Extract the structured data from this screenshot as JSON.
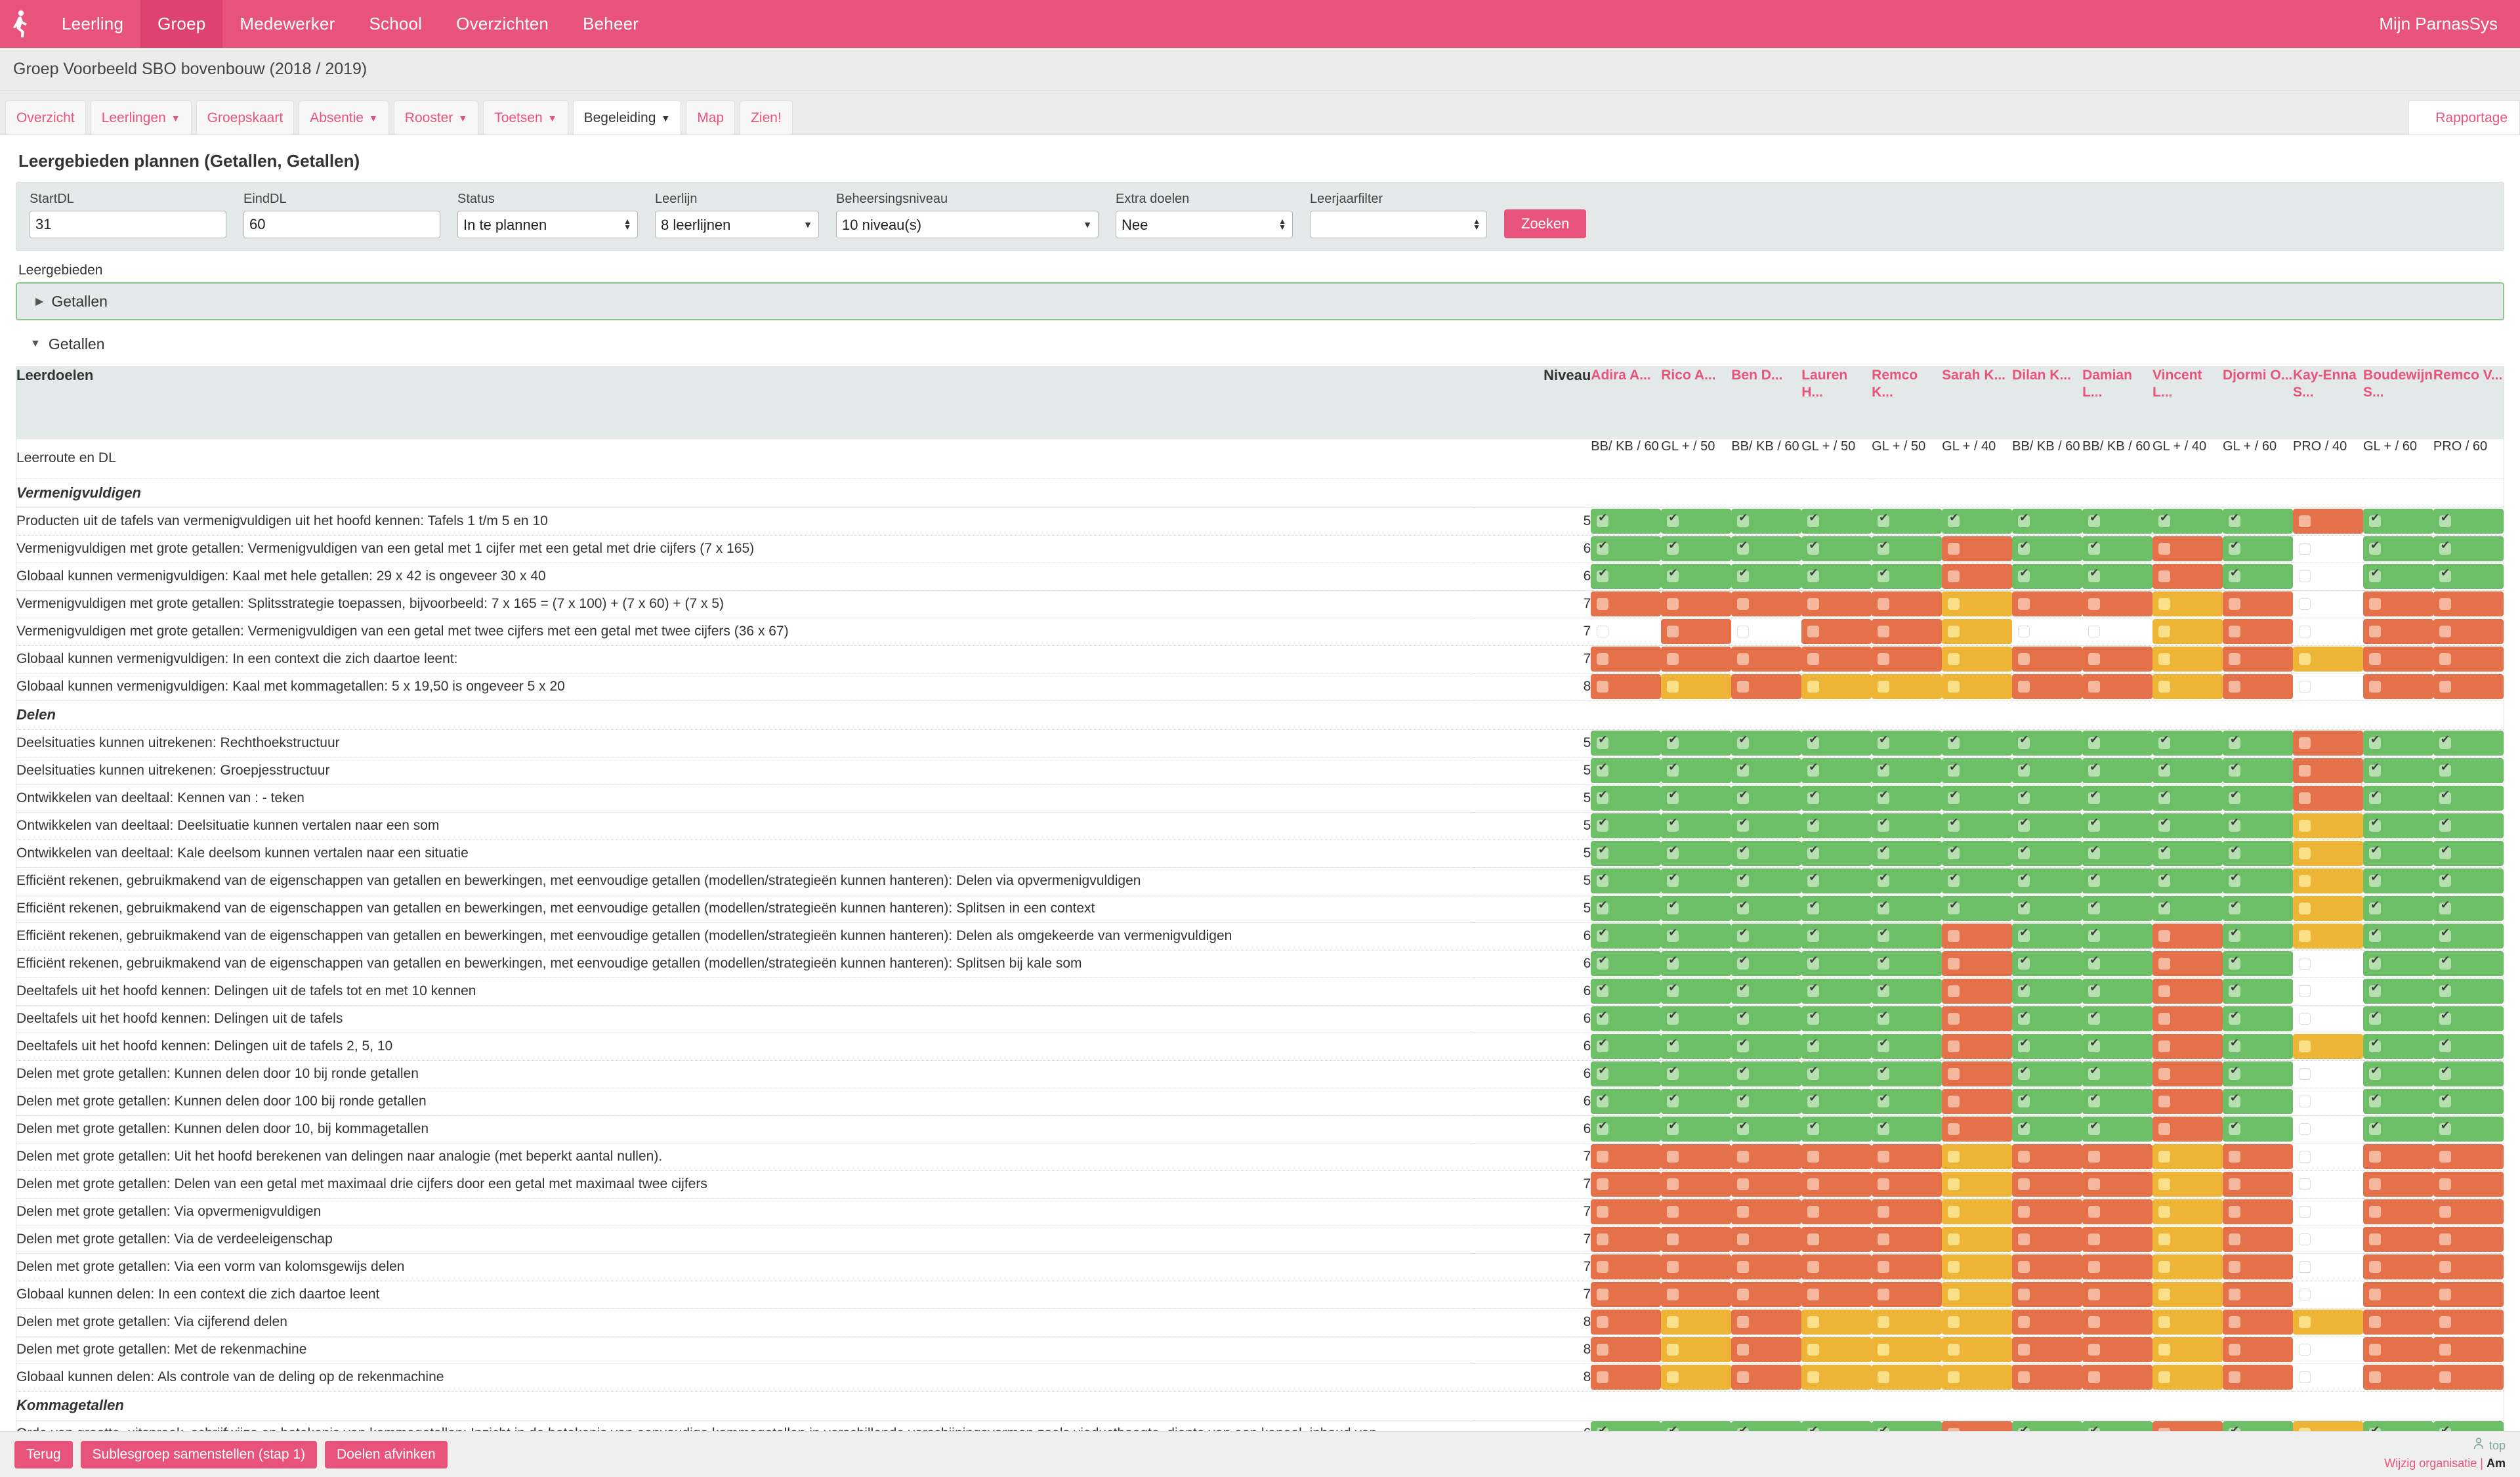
{
  "topnav": {
    "logo_icon": "running-person-logo",
    "items": [
      {
        "label": "Leerling",
        "active": false
      },
      {
        "label": "Groep",
        "active": true
      },
      {
        "label": "Medewerker",
        "active": false
      },
      {
        "label": "School",
        "active": false
      },
      {
        "label": "Overzichten",
        "active": false
      },
      {
        "label": "Beheer",
        "active": false
      }
    ],
    "account_label": "Mijn ParnasSys"
  },
  "titlebar": {
    "title": "Groep Voorbeeld SBO bovenbouw (2018 / 2019)"
  },
  "tabs": [
    {
      "label": "Overzicht",
      "caret": false,
      "active": false
    },
    {
      "label": "Leerlingen",
      "caret": true,
      "active": false
    },
    {
      "label": "Groepskaart",
      "caret": false,
      "active": false
    },
    {
      "label": "Absentie",
      "caret": true,
      "active": false
    },
    {
      "label": "Rooster",
      "caret": true,
      "active": false
    },
    {
      "label": "Toetsen",
      "caret": true,
      "active": false
    },
    {
      "label": "Begeleiding",
      "caret": true,
      "active": true
    },
    {
      "label": "Map",
      "caret": false,
      "active": false
    },
    {
      "label": "Zien!",
      "caret": false,
      "active": false
    }
  ],
  "rapportage_link": "Rapportage",
  "page_title": "Leergebieden plannen (Getallen, Getallen)",
  "filters": {
    "startdl": {
      "label": "StartDL",
      "value": "31"
    },
    "einddl": {
      "label": "EindDL",
      "value": "60"
    },
    "status": {
      "label": "Status",
      "value": "In te plannen"
    },
    "leerlijn": {
      "label": "Leerlijn",
      "value": "8 leerlijnen"
    },
    "beheersingsniveau": {
      "label": "Beheersingsniveau",
      "value": "10 niveau(s)"
    },
    "extra_doelen": {
      "label": "Extra doelen",
      "value": "Nee"
    },
    "leerjaarfilter": {
      "label": "Leerjaarfilter",
      "value": ""
    },
    "search_button": "Zoeken"
  },
  "leergebieden": {
    "label": "Leergebieden",
    "closed_item": "Getallen",
    "open_item": "Getallen"
  },
  "table": {
    "col_goal": "Leerdoelen",
    "col_niveau": "Niveau",
    "route_label": "Leerroute en DL",
    "students": [
      {
        "name": "Adira A...",
        "route": "BB/ KB / 60"
      },
      {
        "name": "Rico A...",
        "route": "GL + / 50"
      },
      {
        "name": "Ben D...",
        "route": "BB/ KB / 60"
      },
      {
        "name": "Lauren H...",
        "route": "GL + / 50"
      },
      {
        "name": "Remco K...",
        "route": "GL + / 50"
      },
      {
        "name": "Sarah K...",
        "route": "GL + / 40"
      },
      {
        "name": "Dilan K...",
        "route": "BB/ KB / 60"
      },
      {
        "name": "Damian L...",
        "route": "BB/ KB / 60"
      },
      {
        "name": "Vincent L...",
        "route": "GL + / 40"
      },
      {
        "name": "Djormi O...",
        "route": "GL + / 60"
      },
      {
        "name": "Kay-Enna S...",
        "route": "PRO / 40"
      },
      {
        "name": "Boudewijn S...",
        "route": "GL + / 60"
      },
      {
        "name": "Remco V...",
        "route": "PRO / 60"
      }
    ],
    "rows": [
      {
        "type": "section",
        "label": "Vermenigvuldigen"
      },
      {
        "type": "goal",
        "label": "Producten uit de tafels van vermenigvuldigen uit het hoofd kennen: Tafels 1 t/m 5 en 10",
        "niveau": "5",
        "cells": [
          "g",
          "g",
          "g",
          "g",
          "g",
          "g",
          "g",
          "g",
          "g",
          "g",
          "o",
          "g",
          "g"
        ]
      },
      {
        "type": "goal",
        "label": "Vermenigvuldigen met grote getallen: Vermenigvuldigen van een getal met 1 cijfer met een getal met drie cijfers (7 x 165)",
        "niveau": "6",
        "cells": [
          "g",
          "g",
          "g",
          "g",
          "g",
          "o",
          "g",
          "g",
          "o",
          "g",
          "n",
          "g",
          "g"
        ]
      },
      {
        "type": "goal",
        "label": "Globaal kunnen vermenigvuldigen: Kaal met hele getallen: 29 x 42 is ongeveer 30 x 40",
        "niveau": "6",
        "cells": [
          "g",
          "g",
          "g",
          "g",
          "g",
          "o",
          "g",
          "g",
          "o",
          "g",
          "n",
          "g",
          "g"
        ]
      },
      {
        "type": "goal",
        "label": "Vermenigvuldigen met grote getallen: Splitsstrategie toepassen, bijvoorbeeld: 7 x 165 = (7 x 100) + (7 x 60) + (7 x 5)",
        "niveau": "7",
        "cells": [
          "o",
          "o",
          "o",
          "o",
          "o",
          "y",
          "o",
          "o",
          "y",
          "o",
          "n",
          "o",
          "o"
        ]
      },
      {
        "type": "goal",
        "label": "Vermenigvuldigen met grote getallen: Vermenigvuldigen van een getal met twee cijfers met een getal met twee cijfers (36 x 67)",
        "niveau": "7",
        "cells": [
          "n",
          "o",
          "n",
          "o",
          "o",
          "y",
          "n",
          "n",
          "y",
          "o",
          "n",
          "o",
          "o"
        ]
      },
      {
        "type": "goal",
        "label": "Globaal kunnen vermenigvuldigen: In een context die zich daartoe leent:",
        "niveau": "7",
        "cells": [
          "o",
          "o",
          "o",
          "o",
          "o",
          "y",
          "o",
          "o",
          "y",
          "o",
          "y",
          "o",
          "o"
        ]
      },
      {
        "type": "goal",
        "label": "Globaal kunnen vermenigvuldigen: Kaal met kommagetallen: 5 x 19,50 is ongeveer 5 x 20",
        "niveau": "8",
        "cells": [
          "o",
          "y",
          "o",
          "y",
          "y",
          "y",
          "o",
          "o",
          "y",
          "o",
          "n",
          "o",
          "o"
        ]
      },
      {
        "type": "section",
        "label": "Delen"
      },
      {
        "type": "goal",
        "label": "Deelsituaties kunnen uitrekenen: Rechthoekstructuur",
        "niveau": "5",
        "cells": [
          "g",
          "g",
          "g",
          "g",
          "g",
          "g",
          "g",
          "g",
          "g",
          "g",
          "o",
          "g",
          "g"
        ]
      },
      {
        "type": "goal",
        "label": "Deelsituaties kunnen uitrekenen: Groepjesstructuur",
        "niveau": "5",
        "cells": [
          "g",
          "g",
          "g",
          "g",
          "g",
          "g",
          "g",
          "g",
          "g",
          "g",
          "o",
          "g",
          "g"
        ]
      },
      {
        "type": "goal",
        "label": "Ontwikkelen van deeltaal: Kennen van : - teken",
        "niveau": "5",
        "cells": [
          "g",
          "g",
          "g",
          "g",
          "g",
          "g",
          "g",
          "g",
          "g",
          "g",
          "o",
          "g",
          "g"
        ]
      },
      {
        "type": "goal",
        "label": "Ontwikkelen van deeltaal: Deelsituatie kunnen vertalen naar een som",
        "niveau": "5",
        "cells": [
          "g",
          "g",
          "g",
          "g",
          "g",
          "g",
          "g",
          "g",
          "g",
          "g",
          "y",
          "g",
          "g"
        ]
      },
      {
        "type": "goal",
        "label": "Ontwikkelen van deeltaal: Kale deelsom kunnen vertalen naar een situatie",
        "niveau": "5",
        "cells": [
          "g",
          "g",
          "g",
          "g",
          "g",
          "g",
          "g",
          "g",
          "g",
          "g",
          "y",
          "g",
          "g"
        ]
      },
      {
        "type": "goal",
        "label": "Efficiënt rekenen, gebruikmakend van de eigenschappen van getallen en bewerkingen, met eenvoudige getallen (modellen/strategieën kunnen hanteren): Delen via opvermenigvuldigen",
        "niveau": "5",
        "cells": [
          "g",
          "g",
          "g",
          "g",
          "g",
          "g",
          "g",
          "g",
          "g",
          "g",
          "y",
          "g",
          "g"
        ]
      },
      {
        "type": "goal",
        "label": "Efficiënt rekenen, gebruikmakend van de eigenschappen van getallen en bewerkingen, met eenvoudige getallen (modellen/strategieën kunnen hanteren): Splitsen in een context",
        "niveau": "5",
        "cells": [
          "g",
          "g",
          "g",
          "g",
          "g",
          "g",
          "g",
          "g",
          "g",
          "g",
          "y",
          "g",
          "g"
        ]
      },
      {
        "type": "goal",
        "label": "Efficiënt rekenen, gebruikmakend van de eigenschappen van getallen en bewerkingen, met eenvoudige getallen (modellen/strategieën kunnen hanteren): Delen als omgekeerde van vermenigvuldigen",
        "niveau": "6",
        "cells": [
          "g",
          "g",
          "g",
          "g",
          "g",
          "o",
          "g",
          "g",
          "o",
          "g",
          "y",
          "g",
          "g"
        ]
      },
      {
        "type": "goal",
        "label": "Efficiënt rekenen, gebruikmakend van de eigenschappen van getallen en bewerkingen, met eenvoudige getallen (modellen/strategieën kunnen hanteren): Splitsen bij kale som",
        "niveau": "6",
        "cells": [
          "g",
          "g",
          "g",
          "g",
          "g",
          "o",
          "g",
          "g",
          "o",
          "g",
          "n",
          "g",
          "g"
        ]
      },
      {
        "type": "goal",
        "label": "Deeltafels uit het hoofd kennen: Delingen uit de tafels tot en met 10 kennen",
        "niveau": "6",
        "cells": [
          "g",
          "g",
          "g",
          "g",
          "g",
          "o",
          "g",
          "g",
          "o",
          "g",
          "n",
          "g",
          "g"
        ]
      },
      {
        "type": "goal",
        "label": "Deeltafels uit het hoofd kennen: Delingen uit de tafels",
        "niveau": "6",
        "cells": [
          "g",
          "g",
          "g",
          "g",
          "g",
          "o",
          "g",
          "g",
          "o",
          "g",
          "n",
          "g",
          "g"
        ]
      },
      {
        "type": "goal",
        "label": "Deeltafels uit het hoofd kennen: Delingen uit de tafels 2, 5, 10",
        "niveau": "6",
        "cells": [
          "g",
          "g",
          "g",
          "g",
          "g",
          "o",
          "g",
          "g",
          "o",
          "g",
          "y",
          "g",
          "g"
        ]
      },
      {
        "type": "goal",
        "label": "Delen met grote getallen: Kunnen delen door 10 bij ronde getallen",
        "niveau": "6",
        "cells": [
          "g",
          "g",
          "g",
          "g",
          "g",
          "o",
          "g",
          "g",
          "o",
          "g",
          "n",
          "g",
          "g"
        ]
      },
      {
        "type": "goal",
        "label": "Delen met grote getallen: Kunnen delen door 100 bij ronde getallen",
        "niveau": "6",
        "cells": [
          "g",
          "g",
          "g",
          "g",
          "g",
          "o",
          "g",
          "g",
          "o",
          "g",
          "n",
          "g",
          "g"
        ]
      },
      {
        "type": "goal",
        "label": "Delen met grote getallen: Kunnen delen door 10, bij kommagetallen",
        "niveau": "6",
        "cells": [
          "g",
          "g",
          "g",
          "g",
          "g",
          "o",
          "g",
          "g",
          "o",
          "g",
          "n",
          "g",
          "g"
        ]
      },
      {
        "type": "goal",
        "label": "Delen met grote getallen: Uit het hoofd berekenen van delingen naar analogie (met beperkt aantal nullen).",
        "niveau": "7",
        "cells": [
          "o",
          "o",
          "o",
          "o",
          "o",
          "y",
          "o",
          "o",
          "y",
          "o",
          "n",
          "o",
          "o"
        ]
      },
      {
        "type": "goal",
        "label": "Delen met grote getallen: Delen van een getal met maximaal drie cijfers door een getal met maximaal twee cijfers",
        "niveau": "7",
        "cells": [
          "o",
          "o",
          "o",
          "o",
          "o",
          "y",
          "o",
          "o",
          "y",
          "o",
          "n",
          "o",
          "o"
        ]
      },
      {
        "type": "goal",
        "label": "Delen met grote getallen: Via opvermenigvuldigen",
        "niveau": "7",
        "cells": [
          "o",
          "o",
          "o",
          "o",
          "o",
          "y",
          "o",
          "o",
          "y",
          "o",
          "n",
          "o",
          "o"
        ]
      },
      {
        "type": "goal",
        "label": "Delen met grote getallen: Via de verdeeleigenschap",
        "niveau": "7",
        "cells": [
          "o",
          "o",
          "o",
          "o",
          "o",
          "y",
          "o",
          "o",
          "y",
          "o",
          "n",
          "o",
          "o"
        ]
      },
      {
        "type": "goal",
        "label": "Delen met grote getallen: Via een vorm van kolomsgewijs delen",
        "niveau": "7",
        "cells": [
          "o",
          "o",
          "o",
          "o",
          "o",
          "y",
          "o",
          "o",
          "y",
          "o",
          "n",
          "o",
          "o"
        ]
      },
      {
        "type": "goal",
        "label": "Globaal kunnen delen: In een context die zich daartoe leent",
        "niveau": "7",
        "cells": [
          "o",
          "o",
          "o",
          "o",
          "o",
          "y",
          "o",
          "o",
          "y",
          "o",
          "n",
          "o",
          "o"
        ]
      },
      {
        "type": "goal",
        "label": "Delen met grote getallen: Via cijferend delen",
        "niveau": "8",
        "cells": [
          "o",
          "y",
          "o",
          "y",
          "y",
          "y",
          "o",
          "o",
          "y",
          "o",
          "y",
          "o",
          "o"
        ]
      },
      {
        "type": "goal",
        "label": "Delen met grote getallen: Met de rekenmachine",
        "niveau": "8",
        "cells": [
          "o",
          "y",
          "o",
          "y",
          "y",
          "y",
          "o",
          "o",
          "y",
          "o",
          "n",
          "o",
          "o"
        ]
      },
      {
        "type": "goal",
        "label": "Globaal kunnen delen: Als controle van de deling op de rekenmachine",
        "niveau": "8",
        "cells": [
          "o",
          "y",
          "o",
          "y",
          "y",
          "y",
          "o",
          "o",
          "y",
          "o",
          "n",
          "o",
          "o"
        ]
      },
      {
        "type": "section",
        "label": "Kommagetallen"
      },
      {
        "type": "goal",
        "label": "Orde van grootte, uitspraak, schrijfwijze en betekenis van kommagetallen: Inzicht in de betekenis van eenvoudige kommagetallen in verschillende verschijningsvormen zoals viaducthoogte, diepte van een kanaal, inhoud van",
        "niveau": "6",
        "cells": [
          "g",
          "g",
          "g",
          "g",
          "g",
          "o",
          "g",
          "g",
          "o",
          "g",
          "y",
          "g",
          "g"
        ]
      }
    ]
  },
  "footer": {
    "buttons": [
      "Terug",
      "Sublesgroep samenstellen (stap 1)",
      "Doelen afvinken"
    ],
    "top_right": "top",
    "org_link": "Wijzig organisatie",
    "separator": "|",
    "account_name": "Am"
  }
}
